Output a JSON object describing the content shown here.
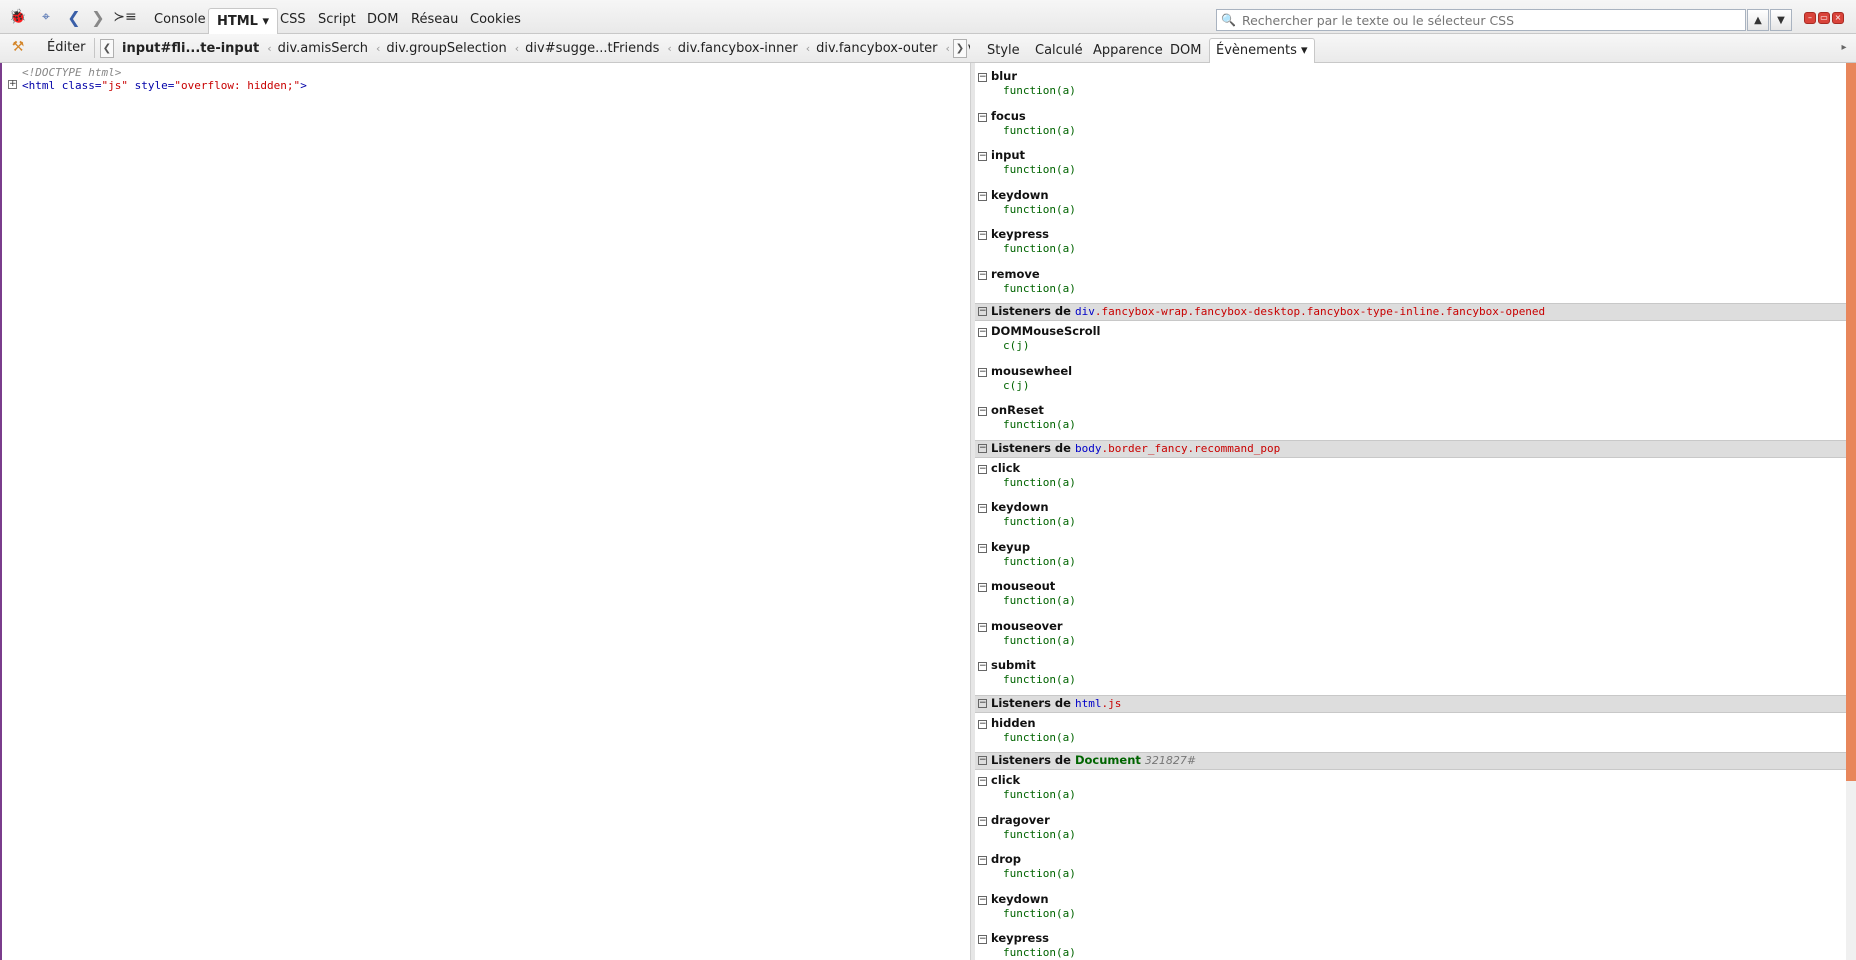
{
  "toolbar": {
    "tabs": [
      {
        "label": "Console"
      },
      {
        "label": "HTML",
        "active": true
      },
      {
        "label": "CSS"
      },
      {
        "label": "Script"
      },
      {
        "label": "DOM"
      },
      {
        "label": "Réseau"
      },
      {
        "label": "Cookies"
      }
    ],
    "html_tab_arrow": "▾",
    "search_placeholder": "Rechercher par le texte ou le sélecteur CSS"
  },
  "subtoolbar": {
    "edit_label": "Éditer",
    "breadcrumbs": [
      "input#fli...te-input",
      "div.amisSerch",
      "div.groupSelection",
      "div#sugge...tFriends",
      "div.fancybox-inner",
      "div.fancybox-outer",
      "div.fancyb"
    ],
    "side_tabs": [
      {
        "label": "Style"
      },
      {
        "label": "Calculé"
      },
      {
        "label": "Apparence"
      },
      {
        "label": "DOM"
      },
      {
        "label": "Évènements ▾",
        "active": true
      }
    ]
  },
  "html_tree": {
    "doctype": "<!DOCTYPE html>",
    "open": "<html",
    "attr1_name": " class=",
    "attr1_value": "\"js\"",
    "attr2_name": " style=",
    "attr2_value": "\"overflow: hidden;\"",
    "close": ">"
  },
  "events": {
    "listeners_label": "Listeners de",
    "block1": [
      {
        "name": "blur",
        "fn": "function(a)"
      },
      {
        "name": "focus",
        "fn": "function(a)"
      },
      {
        "name": "input",
        "fn": "function(a)"
      },
      {
        "name": "keydown",
        "fn": "function(a)"
      },
      {
        "name": "keypress",
        "fn": "function(a)"
      },
      {
        "name": "remove",
        "fn": "function(a)"
      }
    ],
    "group2": {
      "tag": "div",
      "cls": ".fancybox-wrap.fancybox-desktop.fancybox-type-inline.fancybox-opened"
    },
    "block2": [
      {
        "name": "DOMMouseScroll",
        "fn": "c(j)"
      },
      {
        "name": "mousewheel",
        "fn": "c(j)"
      },
      {
        "name": "onReset",
        "fn": "function(a)"
      }
    ],
    "group3": {
      "tag": "body",
      "cls": ".border_fancy.recommand_pop"
    },
    "block3": [
      {
        "name": "click",
        "fn": "function(a)"
      },
      {
        "name": "keydown",
        "fn": "function(a)"
      },
      {
        "name": "keyup",
        "fn": "function(a)"
      },
      {
        "name": "mouseout",
        "fn": "function(a)"
      },
      {
        "name": "mouseover",
        "fn": "function(a)"
      },
      {
        "name": "submit",
        "fn": "function(a)"
      }
    ],
    "group4": {
      "tag": "html",
      "cls": ".js"
    },
    "block4": [
      {
        "name": "hidden",
        "fn": "function(a)"
      }
    ],
    "group5": {
      "doc": "Document",
      "id": "321827#"
    },
    "block5": [
      {
        "name": "click",
        "fn": "function(a)"
      },
      {
        "name": "dragover",
        "fn": "function(a)"
      },
      {
        "name": "drop",
        "fn": "function(a)"
      },
      {
        "name": "keydown",
        "fn": "function(a)"
      },
      {
        "name": "keypress",
        "fn": "function(a)"
      }
    ]
  },
  "colors": {
    "accent_scroll": "#e8865b",
    "tag_blue": "#0000c8",
    "class_red": "#c80000",
    "fn_green": "#006400"
  }
}
